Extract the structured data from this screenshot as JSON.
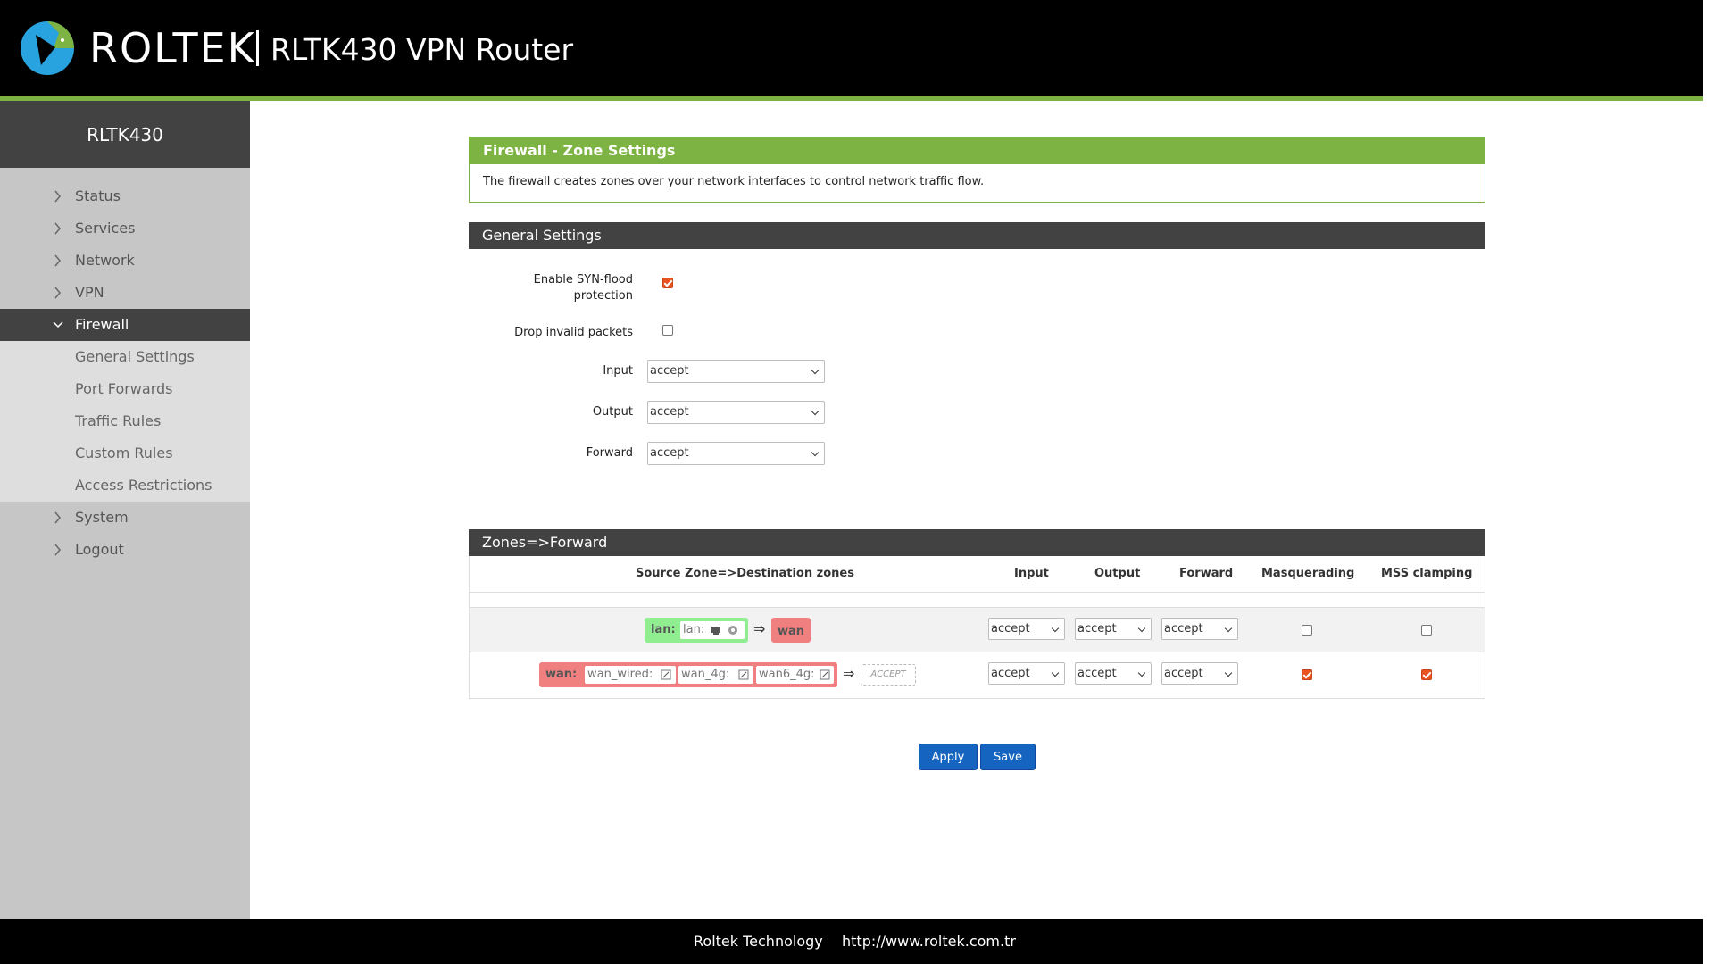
{
  "header": {
    "brand": "ROLTEK",
    "product": "RLTK430 VPN Router"
  },
  "sidebar": {
    "title": "RLTK430",
    "items": [
      {
        "label": "Status"
      },
      {
        "label": "Services"
      },
      {
        "label": "Network"
      },
      {
        "label": "VPN"
      },
      {
        "label": "Firewall"
      },
      {
        "label": "System"
      },
      {
        "label": "Logout"
      }
    ],
    "firewall_sub": [
      "General Settings",
      "Port Forwards",
      "Traffic Rules",
      "Custom Rules",
      "Access Restrictions"
    ]
  },
  "info": {
    "title": "Firewall - Zone Settings",
    "text": "The firewall creates zones over your network interfaces to control network traffic flow."
  },
  "general": {
    "title": "General Settings",
    "syn_label": "Enable SYN-flood protection",
    "syn_checked": true,
    "drop_label": "Drop invalid packets",
    "drop_checked": false,
    "input_label": "Input",
    "input_value": "accept",
    "output_label": "Output",
    "output_value": "accept",
    "forward_label": "Forward",
    "forward_value": "accept"
  },
  "zones": {
    "title": "Zones=>Forward",
    "headers": [
      "Source Zone=>Destination zones",
      "Input",
      "Output",
      "Forward",
      "Masquerading",
      "MSS clamping"
    ],
    "rows": [
      {
        "zone": "lan:",
        "ifaces": [
          "lan:"
        ],
        "arrow": "⇒",
        "dest": "wan",
        "input": "accept",
        "output": "accept",
        "forward": "accept",
        "masq": false,
        "mss": false
      },
      {
        "zone": "wan:",
        "ifaces": [
          "wan_wired:",
          "wan_4g:",
          "wan6_4g:"
        ],
        "arrow": "⇒",
        "dest": "ACCEPT",
        "input": "accept",
        "output": "accept",
        "forward": "accept",
        "masq": true,
        "mss": true
      }
    ]
  },
  "buttons": {
    "apply": "Apply",
    "save": "Save"
  },
  "footer": {
    "company": "Roltek Technology",
    "url": "http://www.roltek.com.tr"
  },
  "colors": {
    "accent": "#7cb342",
    "dark": "#424242",
    "button": "#1565c0",
    "lan_zone": "#90ee90",
    "wan_zone": "#f08080"
  }
}
